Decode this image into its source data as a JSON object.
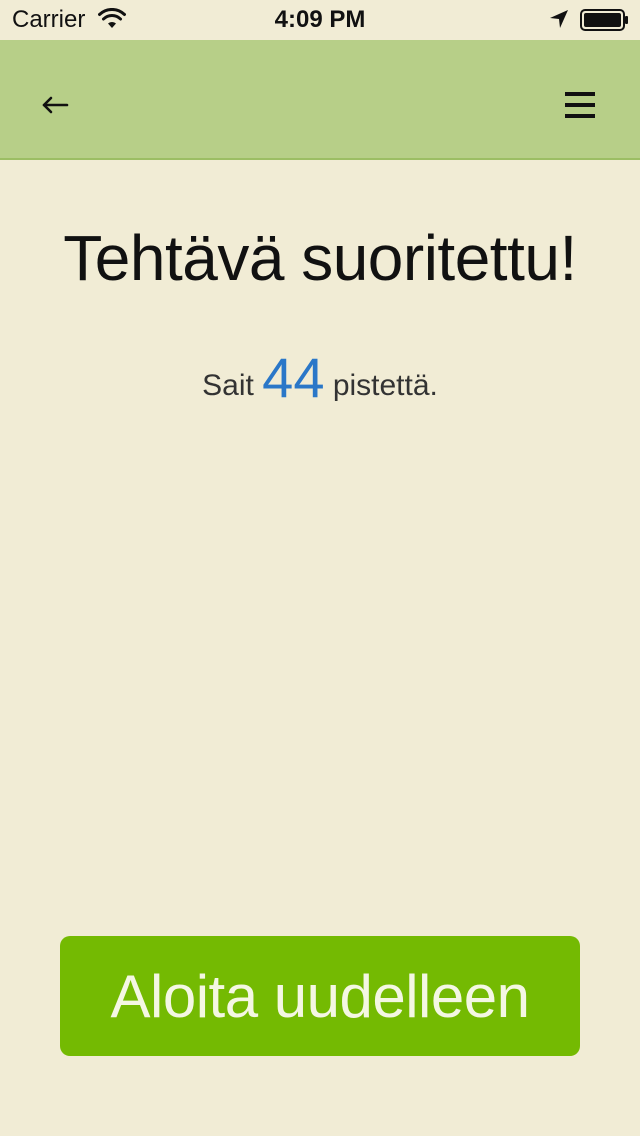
{
  "status_bar": {
    "carrier": "Carrier",
    "time": "4:09 PM",
    "icons": [
      "wifi-icon",
      "location-arrow-icon",
      "battery-icon"
    ]
  },
  "nav": {
    "back_icon": "arrow-left-icon",
    "menu_icon": "hamburger-menu-icon",
    "background_color": "#b7cf88"
  },
  "main": {
    "title": "Tehtävä suoritettu!",
    "score_prefix": "Sait",
    "score_value": "44",
    "score_suffix": "pistettä.",
    "score_color": "#2a77c8"
  },
  "restart_button": {
    "label": "Aloita uudelleen",
    "color": "#74ba02"
  },
  "background_color": "#f1ecd5"
}
